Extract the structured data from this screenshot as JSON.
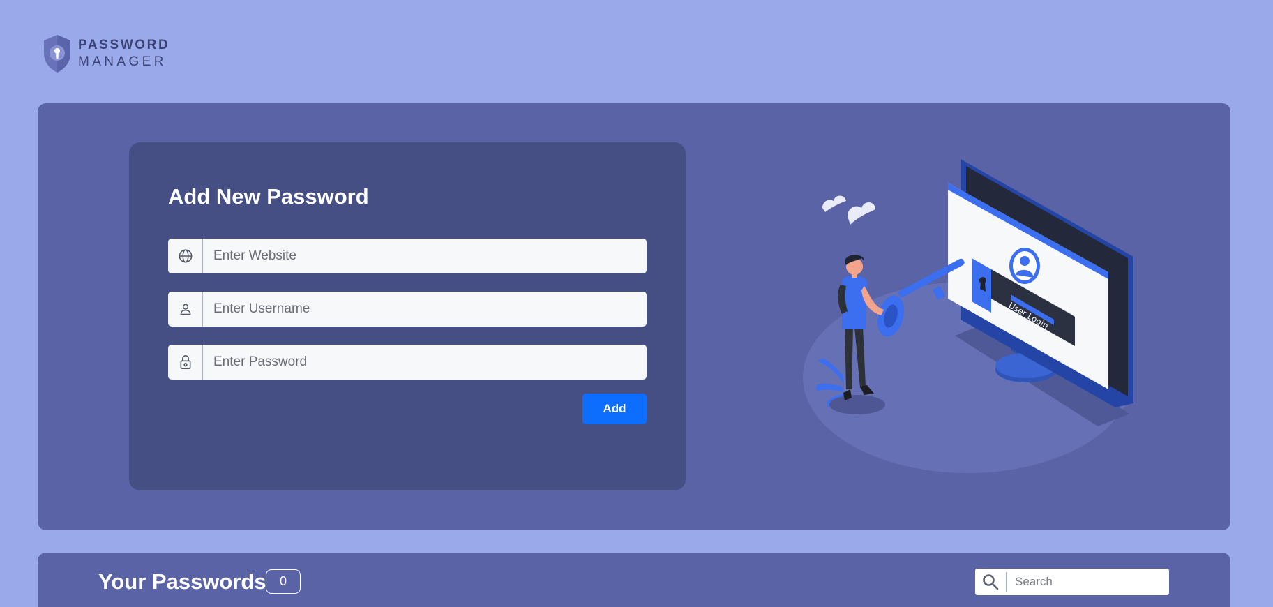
{
  "logo": {
    "line1": "PASSWORD",
    "line2": "MANAGER",
    "icon": "shield-keyhole-icon"
  },
  "add_form": {
    "title": "Add New Password",
    "website": {
      "placeholder": "Enter Website",
      "value": "",
      "icon": "globe-icon"
    },
    "username": {
      "placeholder": "Enter Username",
      "value": "",
      "icon": "user-icon"
    },
    "password": {
      "placeholder": "Enter Password",
      "value": "",
      "icon": "lock-icon"
    },
    "add_label": "Add"
  },
  "illustration": {
    "screen_text": "User Login"
  },
  "passwords": {
    "title": "Your Passwords",
    "count": "0",
    "search": {
      "placeholder": "Search",
      "value": "",
      "icon": "search-icon"
    }
  },
  "colors": {
    "page_bg": "#9aa9ea",
    "panel_bg": "#5963a6",
    "card_bg": "#454f84",
    "accent": "#0d6efd"
  }
}
